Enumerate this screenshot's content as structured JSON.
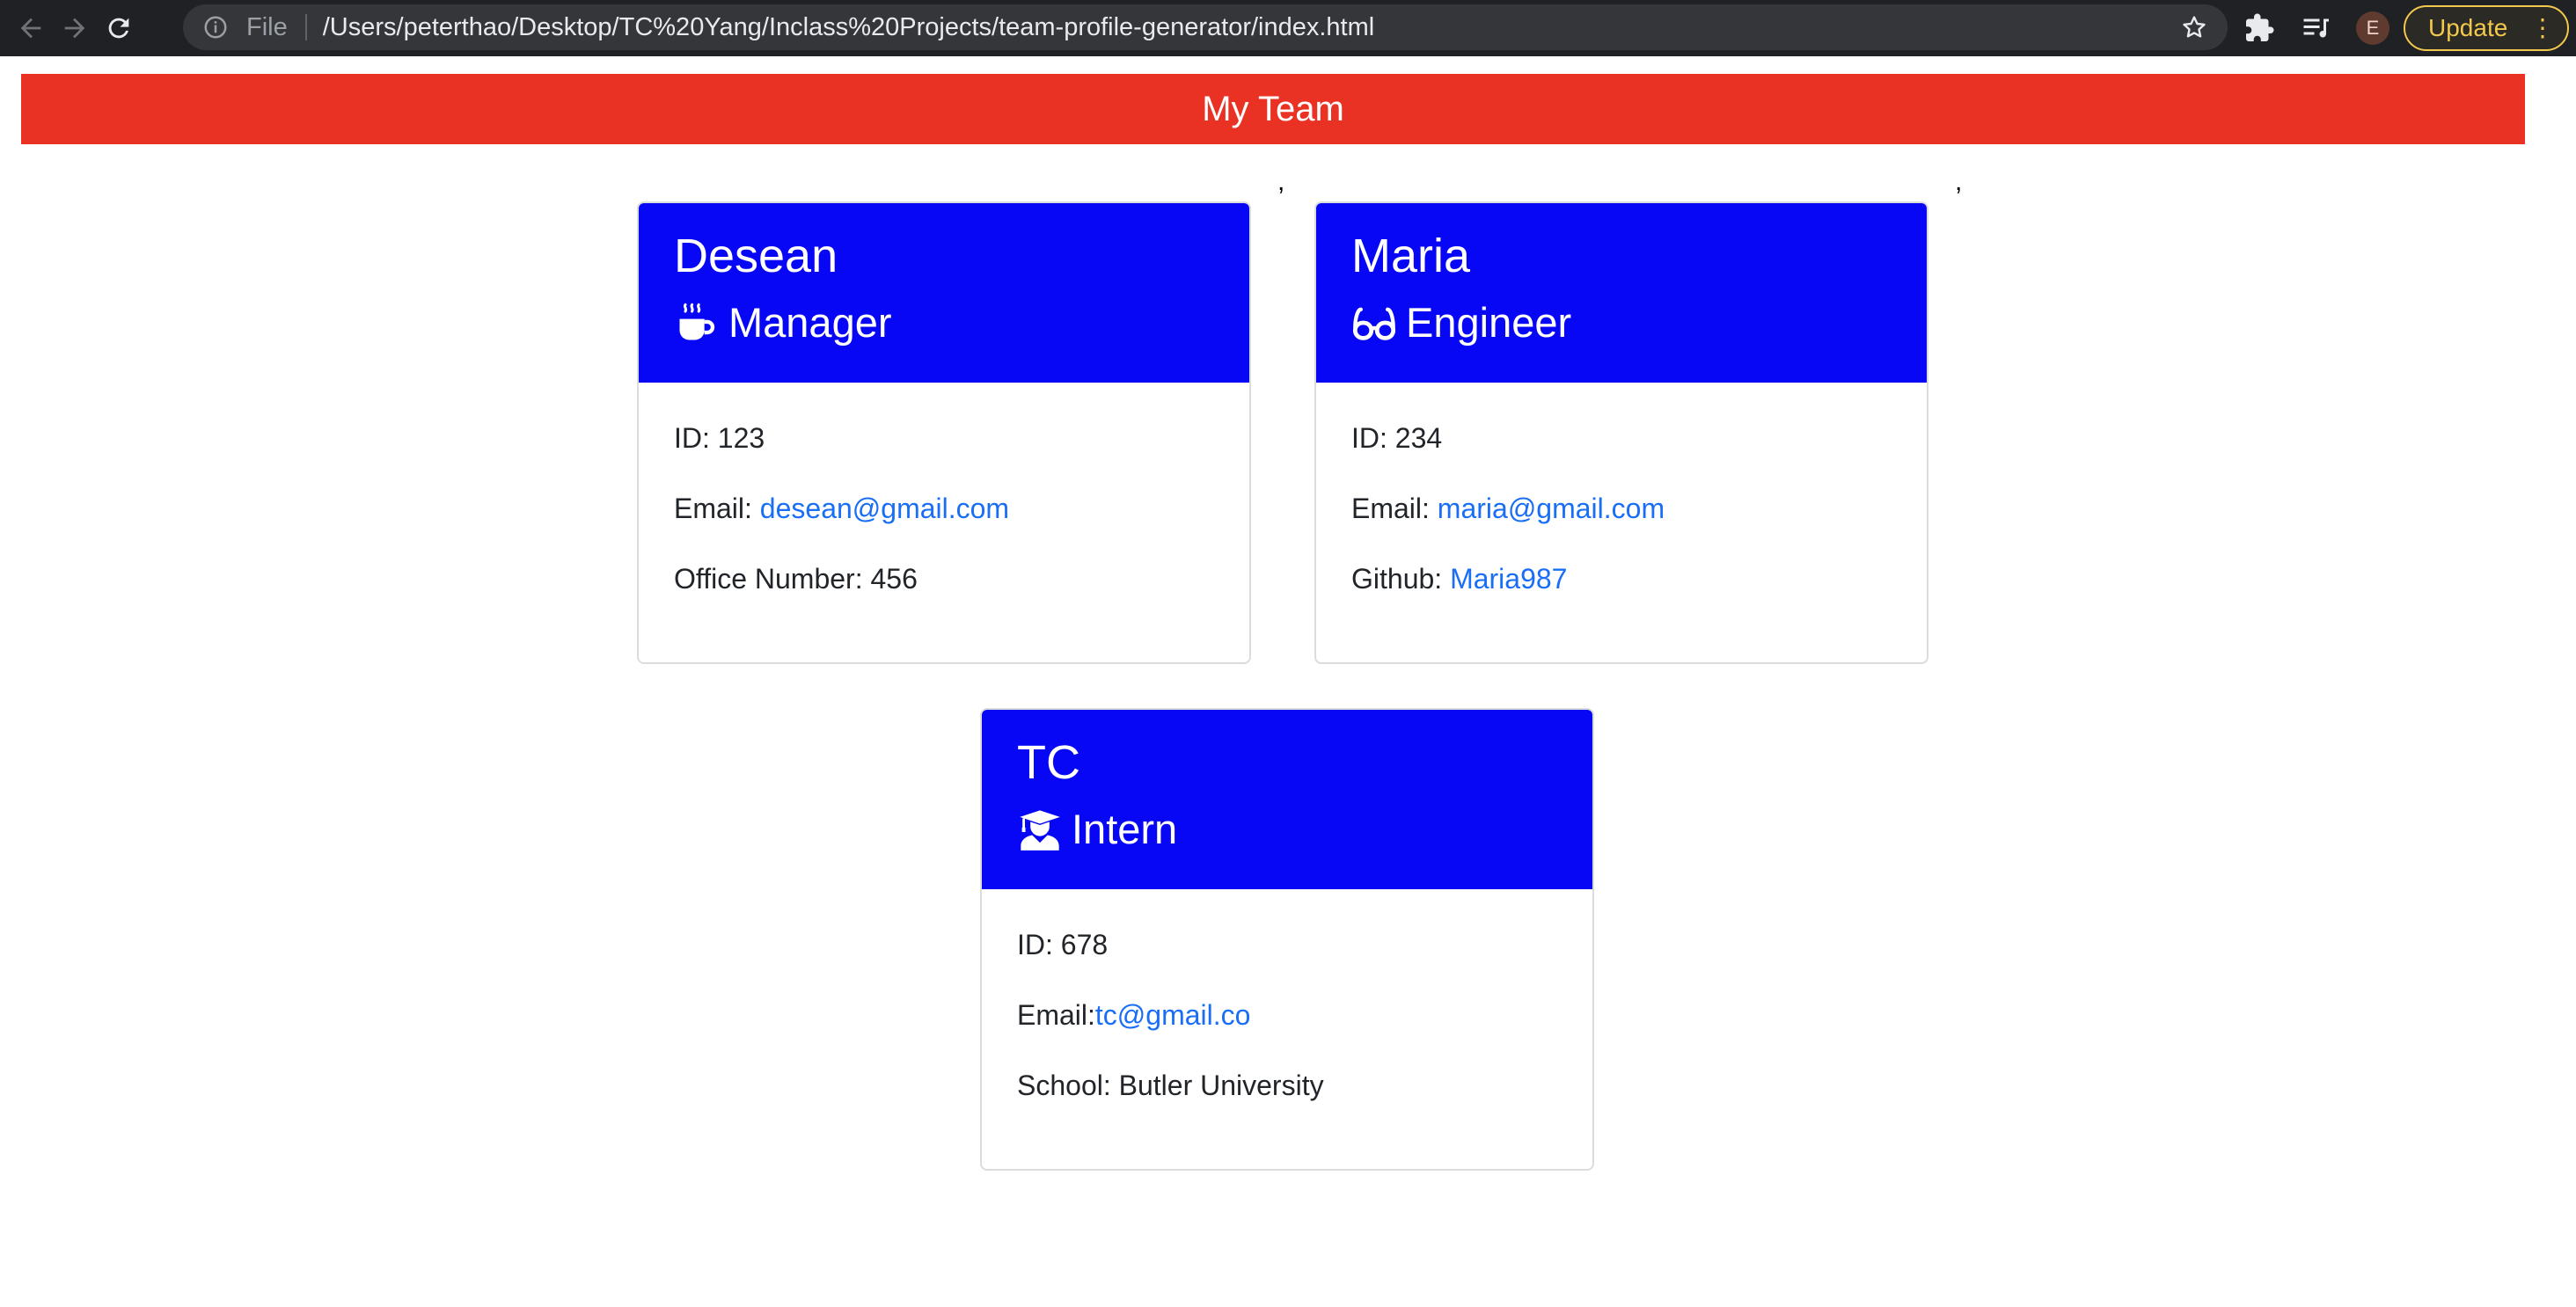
{
  "browser": {
    "file_label": "File",
    "url": "/Users/peterthao/Desktop/TC%20Yang/Inclass%20Projects/team-profile-generator/index.html",
    "avatar_letter": "E",
    "update_label": "Update",
    "menu_glyph": "⋮",
    "accent_color": "#f2c94c"
  },
  "page": {
    "title": "My Team",
    "header_color": "#e93223",
    "card_color": "#0707f5",
    "stray_marks": [
      ",",
      ","
    ]
  },
  "cards": [
    {
      "name": "Desean",
      "role": "Manager",
      "icon": "coffee-mug-icon",
      "id_text": "ID: 123",
      "email_label": "Email: ",
      "email": "desean@gmail.com",
      "extra_label": "Office Number: 456",
      "extra_link": ""
    },
    {
      "name": "Maria",
      "role": "Engineer",
      "icon": "glasses-icon",
      "id_text": "ID: 234",
      "email_label": "Email: ",
      "email": "maria@gmail.com",
      "extra_label": "Github: ",
      "extra_link": "Maria987"
    },
    {
      "name": "TC",
      "role": "Intern",
      "icon": "graduate-icon",
      "id_text": "ID: 678",
      "email_label": "Email:",
      "email": "tc@gmail.co",
      "extra_label": "School: Butler University",
      "extra_link": ""
    }
  ]
}
